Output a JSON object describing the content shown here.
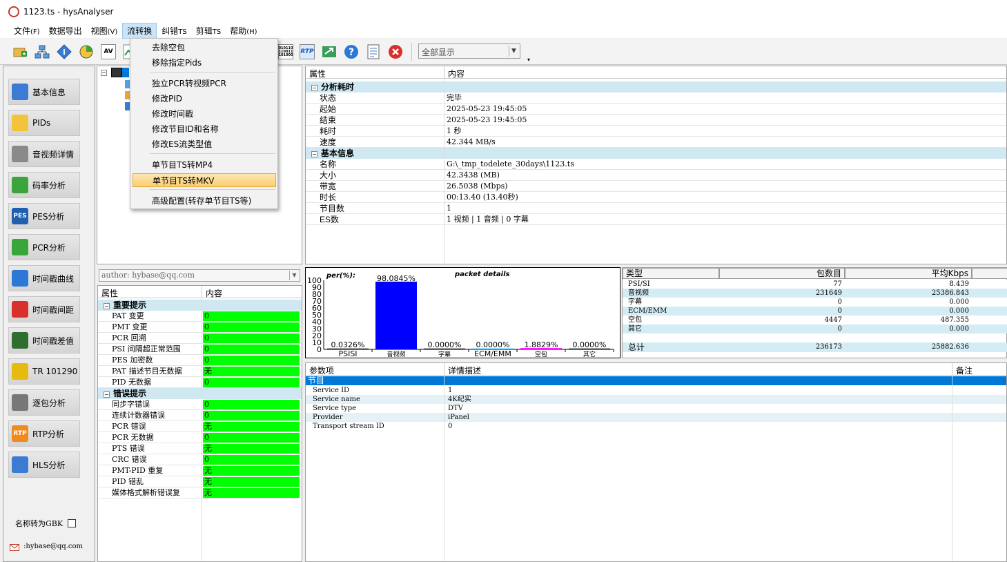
{
  "window": {
    "title": "1123.ts - hysAnalyser"
  },
  "menu": {
    "items": [
      {
        "label": "文件",
        "acc": "(F)"
      },
      {
        "label": "数据导出",
        "acc": ""
      },
      {
        "label": "视图",
        "acc": "(V)"
      },
      {
        "label": "流转换",
        "acc": ""
      },
      {
        "label": "纠错",
        "acc": "TS"
      },
      {
        "label": "剪辑",
        "acc": "TS"
      },
      {
        "label": "帮助",
        "acc": "(H)"
      }
    ]
  },
  "dropdown": {
    "items": [
      "去除空包",
      "移除指定Pids",
      "独立PCR转视频PCR",
      "修改PID",
      "修改时间戳",
      "修改节目ID和名称",
      "修改ES流类型值",
      "单节目TS转MP4",
      "单节目TS转MKV",
      "高级配置(转存单节目TS等)"
    ],
    "highlighted": "单节目TS转MKV"
  },
  "toolbar": {
    "combo_value": "全部显示",
    "icons": [
      "add-file-icon",
      "network-icon",
      "info-icon",
      "pie-chart-icon",
      "av-icon",
      "bitrate-icon",
      "binary-icon",
      "rtp-icon",
      "export-icon",
      "help-icon",
      "report-icon",
      "close-icon"
    ],
    "icon_text": {
      "av": "AV",
      "rtp": "RTP",
      "bin": "010110 110011 101000"
    }
  },
  "sidebar": {
    "buttons": [
      {
        "label": "基本信息",
        "icon": "info-icon"
      },
      {
        "label": "PIDs",
        "icon": "pie-chart-icon"
      },
      {
        "label": "音视频详情",
        "icon": "av-icon"
      },
      {
        "label": "码率分析",
        "icon": "bitrate-icon"
      },
      {
        "label": "PES分析",
        "icon": "pes-icon",
        "icon_text": "PES"
      },
      {
        "label": "PCR分析",
        "icon": "pcr-icon"
      },
      {
        "label": "时间戳曲线",
        "icon": "clock-icon"
      },
      {
        "label": "时间戳间距",
        "icon": "bar-icon"
      },
      {
        "label": "时间戳差值",
        "icon": "wave-icon"
      },
      {
        "label": "TR 101290",
        "icon": "warning-icon"
      },
      {
        "label": "逐包分析",
        "icon": "binary-icon"
      },
      {
        "label": "RTP分析",
        "icon": "rtp-icon",
        "icon_text": "RTP"
      },
      {
        "label": "HLS分析",
        "icon": "hls-icon"
      }
    ],
    "gbk_label": "名称转为GBK",
    "email": ":hybase@qq.com"
  },
  "author": "author: hybase@qq.com",
  "errors": {
    "header": [
      "属性",
      "内容"
    ],
    "groups": [
      {
        "title": "重要提示",
        "rows": [
          [
            "PAT 变更",
            "0"
          ],
          [
            "PMT 变更",
            "0"
          ],
          [
            "PCR 回溯",
            "0"
          ],
          [
            "PSI 间隔超正常范围",
            "0"
          ],
          [
            "PES 加密数",
            "0"
          ],
          [
            "PAT 描述节目无数据",
            "无"
          ],
          [
            "PID 无数据",
            "0"
          ]
        ]
      },
      {
        "title": "错误提示",
        "rows": [
          [
            "同步字错误",
            "0"
          ],
          [
            "连续计数器错误",
            "0"
          ],
          [
            "PCR 错误",
            "无"
          ],
          [
            "PCR 无数据",
            "0"
          ],
          [
            "PTS 错误",
            "无"
          ],
          [
            "CRC 错误",
            "0"
          ],
          [
            "PMT-PID 重复",
            "无"
          ],
          [
            "PID 错乱",
            "无"
          ],
          [
            "媒体格式解析错误复",
            "无"
          ]
        ]
      }
    ]
  },
  "info": {
    "header": [
      "属性",
      "内容"
    ],
    "groups": [
      {
        "title": "分析耗时",
        "rows": [
          [
            "状态",
            "完毕"
          ],
          [
            "起始",
            "2025-05-23 19:45:05"
          ],
          [
            "结束",
            "2025-05-23 19:45:05"
          ],
          [
            "耗时",
            "1 秒"
          ],
          [
            "速度",
            "42.344 MB/s"
          ]
        ]
      },
      {
        "title": "基本信息",
        "rows": [
          [
            "名称",
            "G:\\_tmp_todelete_30days\\1123.ts"
          ],
          [
            "大小",
            "42.3438 (MB)"
          ],
          [
            "带宽",
            "26.5038 (Mbps)"
          ],
          [
            "时长",
            "00:13.40 (13.40秒)"
          ],
          [
            "节目数",
            "1"
          ],
          [
            "ES数",
            "1 视频 | 1 音频 | 0 字幕"
          ]
        ]
      }
    ]
  },
  "chart_data": {
    "type": "bar",
    "title": "packet details",
    "ylabel": "per(%):",
    "ylim": [
      0,
      100
    ],
    "yticks": [
      "100",
      "90",
      "80",
      "70",
      "60",
      "50",
      "40",
      "30",
      "20",
      "10",
      "0"
    ],
    "categories": [
      "PSISI",
      "音视频",
      "字幕",
      "ECM/EMM",
      "空包",
      "其它"
    ],
    "values": [
      0.0326,
      98.0845,
      0.0,
      0.0,
      1.8829,
      0.0
    ],
    "value_labels": [
      "0.0326%",
      "98.0845%",
      "0.0000%",
      "0.0000%",
      "1.8829%",
      "0.0000%"
    ],
    "colors": [
      "#000000",
      "#0000ff",
      "#000000",
      "#00aaff",
      "#ff00ff",
      "#000000"
    ]
  },
  "stats": {
    "header": [
      "类型",
      "包数目",
      "平均Kbps"
    ],
    "rows": [
      [
        "PSI/SI",
        "77",
        "8.439"
      ],
      [
        "音视频",
        "231649",
        "25386.843"
      ],
      [
        "字幕",
        "0",
        "0.000"
      ],
      [
        "ECM/EMM",
        "0",
        "0.000"
      ],
      [
        "空包",
        "4447",
        "487.355"
      ],
      [
        "其它",
        "0",
        "0.000"
      ]
    ],
    "total": [
      "总计",
      "236173",
      "25882.636"
    ]
  },
  "params": {
    "header": [
      "参数项",
      "详情描述",
      "备注"
    ],
    "section": "节目",
    "rows": [
      [
        "Service ID",
        "1"
      ],
      [
        "Service name",
        "4K纪实"
      ],
      [
        "Service type",
        "DTV"
      ],
      [
        "Provider",
        "iPanel"
      ],
      [
        "Transport stream ID",
        "0"
      ]
    ]
  },
  "colors": {
    "selection": "#0078d7",
    "category_bg": "#cfe8f1",
    "ok_green": "#00ff00",
    "highlight": "#fbcf6f"
  }
}
